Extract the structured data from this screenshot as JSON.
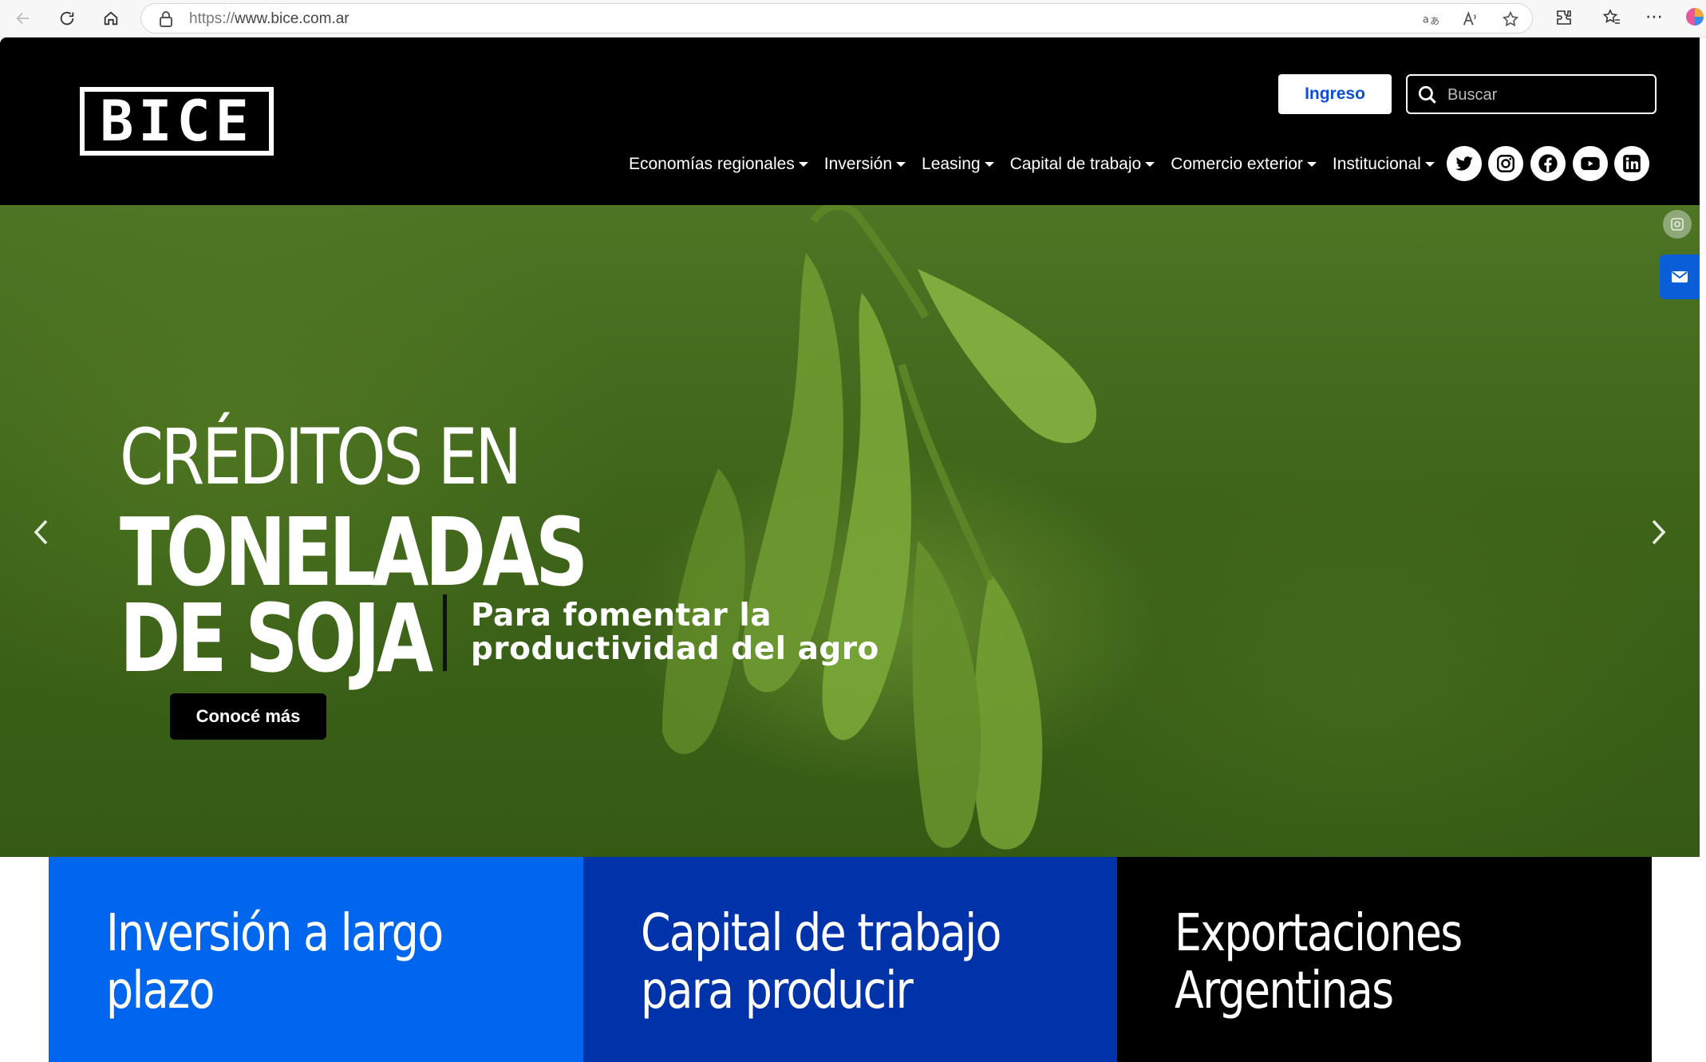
{
  "browser": {
    "url_protocol": "https://",
    "url_host": "www.bice.com.ar"
  },
  "header": {
    "logo_text": "BICE",
    "login_label": "Ingreso",
    "search_placeholder": "Buscar",
    "nav": [
      {
        "label": "Economías regionales"
      },
      {
        "label": "Inversión"
      },
      {
        "label": "Leasing"
      },
      {
        "label": "Capital de trabajo"
      },
      {
        "label": "Comercio exterior"
      },
      {
        "label": "Institucional"
      }
    ],
    "social": [
      "twitter-icon",
      "instagram-icon",
      "facebook-icon",
      "youtube-icon",
      "linkedin-icon"
    ]
  },
  "hero": {
    "line1": "CRÉDITOS EN",
    "line2": "TONELADAS",
    "line3": "DE SOJA",
    "subtitle_line1": "Para fomentar la",
    "subtitle_line2": "productividad del agro",
    "cta_label": "Conocé más"
  },
  "cards": [
    {
      "title": "Inversión a largo plazo",
      "color": "#0066ee"
    },
    {
      "title": "Capital de trabajo para producir",
      "color": "#0033aa"
    },
    {
      "title": "Exportaciones Argentinas",
      "color": "#000000"
    }
  ],
  "colors": {
    "header_bg": "#000000",
    "accent_blue": "#0b4fd6",
    "hero_green": "#3e6419"
  }
}
